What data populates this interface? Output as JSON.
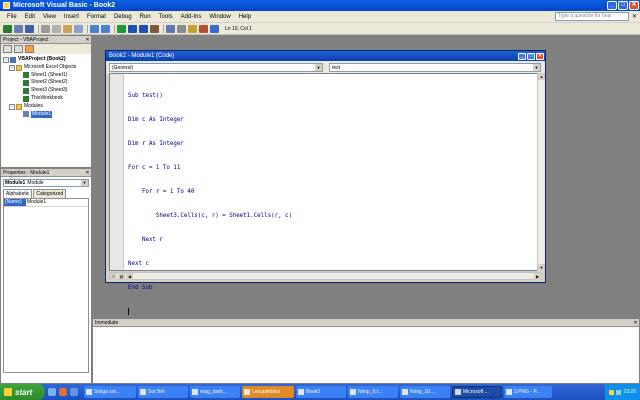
{
  "window": {
    "title": "Microsoft Visual Basic - Book2",
    "min": "_",
    "max": "□",
    "close": "✕"
  },
  "menu": {
    "items": [
      "File",
      "Edit",
      "View",
      "Insert",
      "Format",
      "Debug",
      "Run",
      "Tools",
      "Add-Ins",
      "Window",
      "Help"
    ],
    "help_placeholder": "Type a question for help",
    "close": "✕"
  },
  "toolbar": {
    "status": "Ln 10, Col 1",
    "icons": [
      "excel-icon",
      "insert-module-icon",
      "save-icon",
      "cut-icon",
      "copy-icon",
      "paste-icon",
      "find-icon",
      "undo-icon",
      "redo-icon",
      "run-icon",
      "break-icon",
      "reset-icon",
      "design-mode-icon",
      "project-explorer-icon",
      "properties-icon",
      "object-browser-icon",
      "toolbox-icon",
      "help-icon"
    ]
  },
  "project_panel": {
    "title": "Project - VBAProject",
    "close": "✕",
    "tree": {
      "root": "VBAProject (Book2)",
      "objects_folder": "Microsoft Excel Objects",
      "sheets": [
        "Sheet1 (Sheet1)",
        "Sheet2 (Sheet2)",
        "Sheet3 (Sheet3)"
      ],
      "workbook": "ThisWorkbook",
      "modules_folder": "Modules",
      "module": "Module1"
    }
  },
  "properties_panel": {
    "title": "Properties - Module1",
    "close": "✕",
    "object_combo": "Module1",
    "object_type": "Module",
    "tabs": [
      "Alphabetic",
      "Categorized"
    ],
    "rows": [
      {
        "key": "(Name)",
        "value": "Module1"
      }
    ]
  },
  "code_window": {
    "title": "Book2 - Module1 (Code)",
    "object_combo": "(General)",
    "proc_combo": "test",
    "lines": [
      "Sub test()",
      "Dim c As Integer",
      "Dim r As Integer",
      "For c = 1 To 11",
      "    For r = 1 To 40",
      "        Sheet3.Cells(c, r) = Sheet1.Cells(r, c)",
      "    Next r",
      "Next c",
      "End Sub",
      ""
    ]
  },
  "immediate": {
    "title": "Immediate",
    "close": "✕"
  },
  "taskbar": {
    "start_label": "start",
    "tasks": [
      {
        "label": "Soliga sol...",
        "style": "normal"
      },
      {
        "label": "SocTeh",
        "style": "normal"
      },
      {
        "label": "mag_darb...",
        "style": "normal"
      },
      {
        "label": "Lesupeltides",
        "style": "orange"
      },
      {
        "label": "Book2",
        "style": "normal"
      },
      {
        "label": "Nimp_9.t...",
        "style": "normal"
      },
      {
        "label": "Nimp_10....",
        "style": "normal"
      },
      {
        "label": "Microsoft ...",
        "style": "active"
      },
      {
        "label": "3.PNG - P...",
        "style": "normal"
      }
    ],
    "clock": "23:26"
  }
}
